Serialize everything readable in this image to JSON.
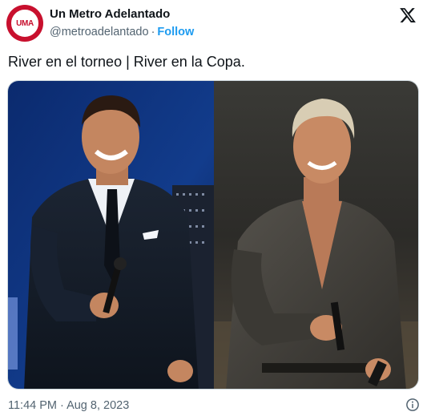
{
  "author": {
    "display_name": "Un Metro Adelantado",
    "handle": "@metroadelantado",
    "follow_label": "Follow",
    "avatar_text": "UMA",
    "avatar_color": "#c8102e"
  },
  "tweet": {
    "text": "River en el torneo | River en la Copa.",
    "timestamp": "11:44 PM · Aug 8, 2023"
  },
  "icons": {
    "platform": "x-logo-icon",
    "info": "info-icon"
  },
  "colors": {
    "link": "#1d9bf0",
    "secondary_text": "#536471"
  }
}
